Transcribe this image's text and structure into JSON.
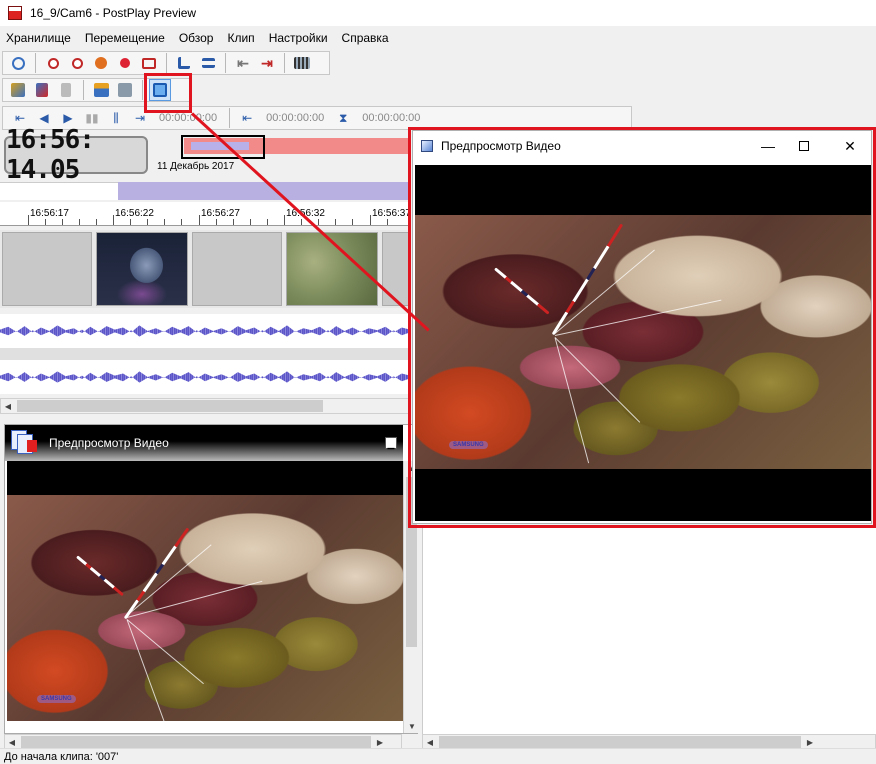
{
  "window": {
    "title": "16_9/Cam6 - PostPlay Preview"
  },
  "menu": [
    "Хранилище",
    "Перемещение",
    "Обзор",
    "Клип",
    "Настройки",
    "Справка"
  ],
  "toolbar": {
    "timecodes": [
      "00:00:00:00",
      "00:00:00:00",
      "00:00:00:00"
    ]
  },
  "clock": {
    "time": "16:56: 14.05"
  },
  "navigator": {
    "date": "11 Декабрь 2017"
  },
  "timeline": {
    "ticks": [
      "16:56:17",
      "16:56:22",
      "16:56:27",
      "16:56:32",
      "16:56:37"
    ]
  },
  "dock_panel": {
    "title": "Предпросмотр Видео"
  },
  "float_window": {
    "title": "Предпросмотр Видео"
  },
  "video": {
    "watermark": "SAMSUNG"
  },
  "statusbar": {
    "text": "До начала клипа: '007'"
  },
  "colors": {
    "annotation_red": "#e0141e",
    "timeline_range": "#b8b0e0",
    "navigator_strip": "#f28a8a",
    "waveform": "#5b55c8"
  },
  "icons": [
    "undo-icon",
    "zoom-in-icon",
    "zoom-out-icon",
    "zoom-fit-icon",
    "zoom-reset-icon",
    "record-icon",
    "snap-icon",
    "align-icon",
    "go-start-icon",
    "go-end-icon",
    "film-icon",
    "mark-in-icon",
    "mark-out-icon",
    "export-icon",
    "clip-icon",
    "preview-window-icon"
  ]
}
